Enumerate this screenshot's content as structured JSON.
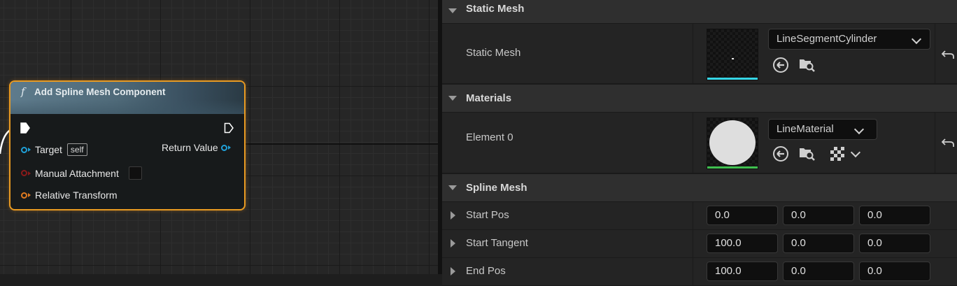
{
  "node": {
    "title": "Add Spline Mesh Component",
    "function_glyph": "f",
    "pins": {
      "target_label": "Target",
      "target_default": "self",
      "manual_attachment_label": "Manual Attachment",
      "relative_transform_label": "Relative Transform",
      "return_value_label": "Return Value"
    }
  },
  "details": {
    "categories": {
      "static_mesh": "Static Mesh",
      "materials": "Materials",
      "spline_mesh": "Spline Mesh"
    },
    "static_mesh": {
      "label": "Static Mesh",
      "asset": "LineSegmentCylinder"
    },
    "materials": {
      "label": "Element 0",
      "asset": "LineMaterial"
    },
    "spline_mesh": {
      "start_pos": {
        "label": "Start Pos",
        "x": "0.0",
        "y": "0.0",
        "z": "0.0"
      },
      "start_tangent": {
        "label": "Start Tangent",
        "x": "100.0",
        "y": "0.0",
        "z": "0.0"
      },
      "end_pos": {
        "label": "End Pos",
        "x": "100.0",
        "y": "0.0",
        "z": "0.0"
      }
    }
  },
  "colors": {
    "node_border": "#e89a22",
    "exec_pin": "#ffffff",
    "object_pin": "#1fa0d8",
    "bool_pin": "#8a1a1a",
    "struct_pin": "#e07a20",
    "mesh_thumb_bar": "#35d6e6",
    "material_thumb_bar": "#3fbf4f"
  }
}
